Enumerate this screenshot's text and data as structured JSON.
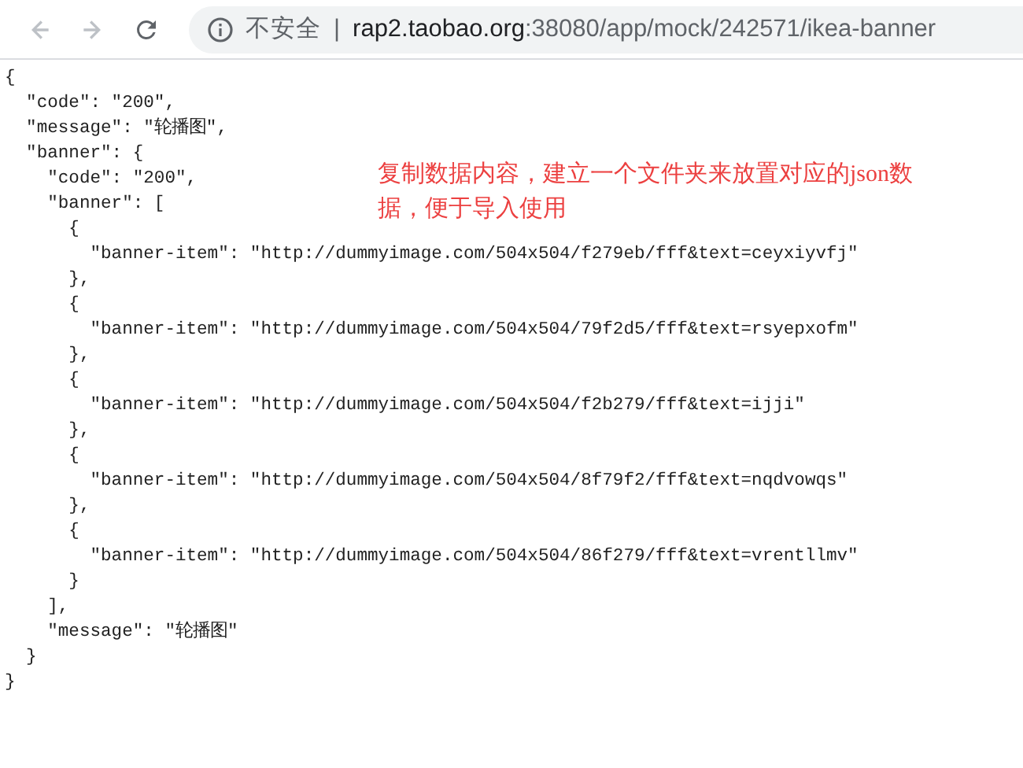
{
  "toolbar": {
    "back": {
      "disabled": true
    },
    "forward": {
      "disabled": true
    },
    "security_label": "不安全",
    "separator": "|",
    "url_host": "rap2.taobao.org",
    "url_rest": ":38080/app/mock/242571/ikea-banner"
  },
  "code_lines": [
    "{",
    "  \"code\": \"200\",",
    "  \"message\": \"轮播图\",",
    "  \"banner\": {",
    "    \"code\": \"200\",",
    "    \"banner\": [",
    "      {",
    "        \"banner-item\": \"http://dummyimage.com/504x504/f279eb/fff&text=ceyxiyvfj\"",
    "      },",
    "      {",
    "        \"banner-item\": \"http://dummyimage.com/504x504/79f2d5/fff&text=rsyepxofm\"",
    "      },",
    "      {",
    "        \"banner-item\": \"http://dummyimage.com/504x504/f2b279/fff&text=ijji\"",
    "      },",
    "      {",
    "        \"banner-item\": \"http://dummyimage.com/504x504/8f79f2/fff&text=nqdvowqs\"",
    "      },",
    "      {",
    "        \"banner-item\": \"http://dummyimage.com/504x504/86f279/fff&text=vrentllmv\"",
    "      }",
    "    ],",
    "    \"message\": \"轮播图\"",
    "  }",
    "}"
  ],
  "annotation": "复制数据内容，建立一个文件夹来放置对应的json数据，便于导入使用"
}
